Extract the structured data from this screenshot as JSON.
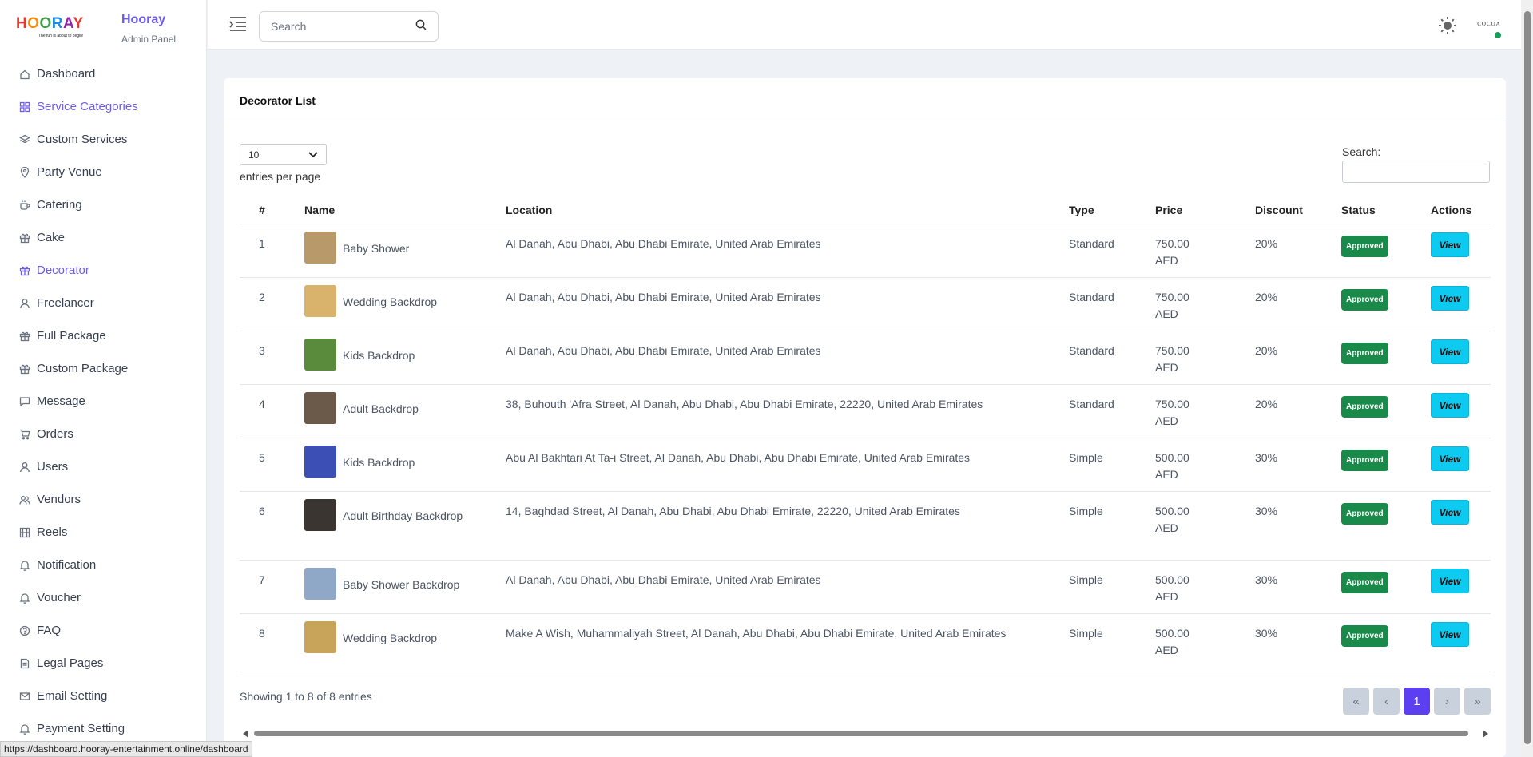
{
  "brand": {
    "logo_text": "HOORAY",
    "tagline": "The fun is about to begin!",
    "name": "Hooray",
    "subtitle": "Admin Panel"
  },
  "sidebar": {
    "items": [
      {
        "label": "Dashboard",
        "icon": "home-icon",
        "active": false
      },
      {
        "label": "Service Categories",
        "icon": "grid-icon",
        "active": true
      },
      {
        "label": "Custom Services",
        "icon": "layers-icon",
        "active": false
      },
      {
        "label": "Party Venue",
        "icon": "map-pin-icon",
        "active": false
      },
      {
        "label": "Catering",
        "icon": "coffee-icon",
        "active": false
      },
      {
        "label": "Cake",
        "icon": "gift-icon",
        "active": false
      },
      {
        "label": "Decorator",
        "icon": "gift-icon",
        "active": true
      },
      {
        "label": "Freelancer",
        "icon": "user-icon",
        "active": false
      },
      {
        "label": "Full Package",
        "icon": "gift-icon",
        "active": false
      },
      {
        "label": "Custom Package",
        "icon": "gift-icon",
        "active": false
      },
      {
        "label": "Message",
        "icon": "message-icon",
        "active": false
      },
      {
        "label": "Orders",
        "icon": "cart-icon",
        "active": false
      },
      {
        "label": "Users",
        "icon": "user-icon",
        "active": false
      },
      {
        "label": "Vendors",
        "icon": "users-icon",
        "active": false
      },
      {
        "label": "Reels",
        "icon": "film-icon",
        "active": false
      },
      {
        "label": "Notification",
        "icon": "bell-icon",
        "active": false
      },
      {
        "label": "Voucher",
        "icon": "bell-icon",
        "active": false
      },
      {
        "label": "FAQ",
        "icon": "help-icon",
        "active": false
      },
      {
        "label": "Legal Pages",
        "icon": "document-icon",
        "active": false
      },
      {
        "label": "Email Setting",
        "icon": "mail-icon",
        "active": false
      },
      {
        "label": "Payment Setting",
        "icon": "bell-icon",
        "active": false
      }
    ]
  },
  "topbar": {
    "search_placeholder": "Search",
    "avatar_text": "COCOA"
  },
  "page": {
    "title": "Decorator List",
    "entries_value": "10",
    "entries_label": "entries per page",
    "search_label": "Search:",
    "columns": [
      "#",
      "Name",
      "Location",
      "Type",
      "Price",
      "Discount",
      "Status",
      "Actions"
    ],
    "rows": [
      {
        "idx": "1",
        "name": "Baby Shower",
        "location": "Al Danah, Abu Dhabi, Abu Dhabi Emirate, United Arab Emirates",
        "type": "Standard",
        "price": "750.00 AED",
        "discount": "20%",
        "status": "Approved",
        "action": "View",
        "thumb_color": "#b89a6a"
      },
      {
        "idx": "2",
        "name": "Wedding Backdrop",
        "location": "Al Danah, Abu Dhabi, Abu Dhabi Emirate, United Arab Emirates",
        "type": "Standard",
        "price": "750.00 AED",
        "discount": "20%",
        "status": "Approved",
        "action": "View",
        "thumb_color": "#d9b36b"
      },
      {
        "idx": "3",
        "name": "Kids Backdrop",
        "location": "Al Danah, Abu Dhabi, Abu Dhabi Emirate, United Arab Emirates",
        "type": "Standard",
        "price": "750.00 AED",
        "discount": "20%",
        "status": "Approved",
        "action": "View",
        "thumb_color": "#5a8a3c"
      },
      {
        "idx": "4",
        "name": "Adult Backdrop",
        "location": "38, Buhouth 'Afra Street, Al Danah, Abu Dhabi, Abu Dhabi Emirate, 22220, United Arab Emirates",
        "type": "Standard",
        "price": "750.00 AED",
        "discount": "20%",
        "status": "Approved",
        "action": "View",
        "thumb_color": "#6b5a4a"
      },
      {
        "idx": "5",
        "name": "Kids Backdrop",
        "location": "Abu Al Bakhtari At Ta-i Street, Al Danah, Abu Dhabi, Abu Dhabi Emirate, United Arab Emirates",
        "type": "Simple",
        "price": "500.00 AED",
        "discount": "30%",
        "status": "Approved",
        "action": "View",
        "thumb_color": "#3b4fb5"
      },
      {
        "idx": "6",
        "name": "Adult Birthday Backdrop",
        "location": "14, Baghdad Street, Al Danah, Abu Dhabi, Abu Dhabi Emirate, 22220, United Arab Emirates",
        "type": "Simple",
        "price": "500.00 AED",
        "discount": "30%",
        "status": "Approved",
        "action": "View",
        "thumb_color": "#3a3530"
      },
      {
        "idx": "7",
        "name": "Baby Shower Backdrop",
        "location": "Al Danah, Abu Dhabi, Abu Dhabi Emirate, United Arab Emirates",
        "type": "Simple",
        "price": "500.00 AED",
        "discount": "30%",
        "status": "Approved",
        "action": "View",
        "thumb_color": "#8fa8c8"
      },
      {
        "idx": "8",
        "name": "Wedding Backdrop",
        "location": "Make A Wish, Muhammaliyah Street, Al Danah, Abu Dhabi, Abu Dhabi Emirate, United Arab Emirates",
        "type": "Simple",
        "price": "500.00 AED",
        "discount": "30%",
        "status": "Approved",
        "action": "View",
        "thumb_color": "#c8a45a"
      }
    ],
    "info": "Showing 1 to 8 of 8 entries",
    "pager": [
      "«",
      "‹",
      "1",
      "›",
      "»"
    ]
  },
  "status_bar_url": "https://dashboard.hooray-entertainment.online/dashboard",
  "colors": {
    "accent": "#6c5ce7",
    "approved": "#1a8a4a",
    "view_button": "#0dcaf0",
    "pager_current": "#5b3ff0"
  }
}
